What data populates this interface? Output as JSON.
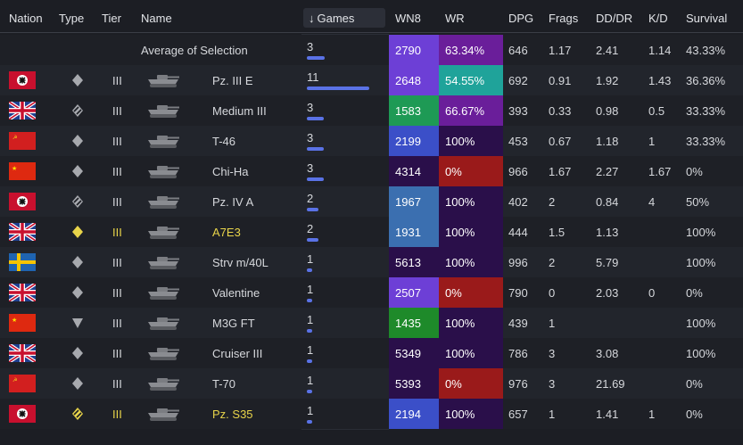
{
  "header": {
    "nation": "Nation",
    "type": "Type",
    "tier": "Tier",
    "name": "Name",
    "games": "Games",
    "wn8": "WN8",
    "wr": "WR",
    "dpg": "DPG",
    "frags": "Frags",
    "dddr": "DD/DR",
    "kd": "K/D",
    "survival": "Survival"
  },
  "average": {
    "label": "Average of Selection",
    "games": "3",
    "games_fraction": 0.2,
    "wn8": "2790",
    "wn8_color": "#6d3fd6",
    "wr": "63.34%",
    "wr_color": "#6a1e9a",
    "dpg": "646",
    "frags": "1.17",
    "dddr": "2.41",
    "kd": "1.14",
    "survival": "43.33%"
  },
  "rows": [
    {
      "nation": "germany",
      "type": "light-tank-icon",
      "tier": "III",
      "name": "Pz. III E",
      "premium": false,
      "games": "11",
      "games_fraction": 1.0,
      "wn8": "2648",
      "wn8_color": "#6d3fd6",
      "wr": "54.55%",
      "wr_color": "#1fa39a",
      "dpg": "692",
      "frags": "0.91",
      "dddr": "1.92",
      "kd": "1.43",
      "survival": "36.36%"
    },
    {
      "nation": "uk",
      "type": "medium-tank-icon",
      "tier": "III",
      "name": "Medium III",
      "premium": false,
      "games": "3",
      "games_fraction": 0.27,
      "wn8": "1583",
      "wn8_color": "#1e9a55",
      "wr": "66.67%",
      "wr_color": "#6a1e9a",
      "dpg": "393",
      "frags": "0.33",
      "dddr": "0.98",
      "kd": "0.5",
      "survival": "33.33%"
    },
    {
      "nation": "ussr",
      "type": "light-tank-icon",
      "tier": "III",
      "name": "T-46",
      "premium": false,
      "games": "3",
      "games_fraction": 0.27,
      "wn8": "2199",
      "wn8_color": "#3b4fc8",
      "wr": "100%",
      "wr_color": "#2a0f4a",
      "dpg": "453",
      "frags": "0.67",
      "dddr": "1.18",
      "kd": "1",
      "survival": "33.33%"
    },
    {
      "nation": "china",
      "type": "light-tank-icon",
      "tier": "III",
      "name": "Chi-Ha",
      "premium": false,
      "games": "3",
      "games_fraction": 0.27,
      "wn8": "4314",
      "wn8_color": "#2a0f4a",
      "wr": "0%",
      "wr_color": "#9a1a1a",
      "dpg": "966",
      "frags": "1.67",
      "dddr": "2.27",
      "kd": "1.67",
      "survival": "0%"
    },
    {
      "nation": "germany",
      "type": "medium-tank-icon",
      "tier": "III",
      "name": "Pz. IV A",
      "premium": false,
      "games": "2",
      "games_fraction": 0.18,
      "wn8": "1967",
      "wn8_color": "#3b6fb0",
      "wr": "100%",
      "wr_color": "#2a0f4a",
      "dpg": "402",
      "frags": "2",
      "dddr": "0.84",
      "kd": "4",
      "survival": "50%"
    },
    {
      "nation": "uk",
      "type": "light-tank-icon",
      "tier": "III",
      "name": "A7E3",
      "premium": true,
      "games": "2",
      "games_fraction": 0.18,
      "wn8": "1931",
      "wn8_color": "#3b6fb0",
      "wr": "100%",
      "wr_color": "#2a0f4a",
      "dpg": "444",
      "frags": "1.5",
      "dddr": "1.13",
      "kd": "",
      "survival": "100%"
    },
    {
      "nation": "sweden",
      "type": "light-tank-icon",
      "tier": "III",
      "name": "Strv m/40L",
      "premium": false,
      "games": "1",
      "games_fraction": 0.09,
      "wn8": "5613",
      "wn8_color": "#2a0f4a",
      "wr": "100%",
      "wr_color": "#2a0f4a",
      "dpg": "996",
      "frags": "2",
      "dddr": "5.79",
      "kd": "",
      "survival": "100%"
    },
    {
      "nation": "uk",
      "type": "light-tank-icon",
      "tier": "III",
      "name": "Valentine",
      "premium": false,
      "games": "1",
      "games_fraction": 0.09,
      "wn8": "2507",
      "wn8_color": "#6d3fd6",
      "wr": "0%",
      "wr_color": "#9a1a1a",
      "dpg": "790",
      "frags": "0",
      "dddr": "2.03",
      "kd": "0",
      "survival": "0%"
    },
    {
      "nation": "china",
      "type": "td-icon",
      "tier": "III",
      "name": "M3G FT",
      "premium": false,
      "games": "1",
      "games_fraction": 0.09,
      "wn8": "1435",
      "wn8_color": "#1e8a2a",
      "wr": "100%",
      "wr_color": "#2a0f4a",
      "dpg": "439",
      "frags": "1",
      "dddr": "",
      "kd": "",
      "survival": "100%"
    },
    {
      "nation": "uk",
      "type": "light-tank-icon",
      "tier": "III",
      "name": "Cruiser III",
      "premium": false,
      "games": "1",
      "games_fraction": 0.09,
      "wn8": "5349",
      "wn8_color": "#2a0f4a",
      "wr": "100%",
      "wr_color": "#2a0f4a",
      "dpg": "786",
      "frags": "3",
      "dddr": "3.08",
      "kd": "",
      "survival": "100%"
    },
    {
      "nation": "ussr",
      "type": "light-tank-icon",
      "tier": "III",
      "name": "T-70",
      "premium": false,
      "games": "1",
      "games_fraction": 0.09,
      "wn8": "5393",
      "wn8_color": "#2a0f4a",
      "wr": "0%",
      "wr_color": "#9a1a1a",
      "dpg": "976",
      "frags": "3",
      "dddr": "21.69",
      "kd": "",
      "survival": "0%"
    },
    {
      "nation": "germany",
      "type": "medium-tank-icon",
      "tier": "III",
      "name": "Pz. S35",
      "premium": true,
      "games": "1",
      "games_fraction": 0.09,
      "wn8": "2194",
      "wn8_color": "#3b4fc8",
      "wr": "100%",
      "wr_color": "#2a0f4a",
      "dpg": "657",
      "frags": "1",
      "dddr": "1.41",
      "kd": "1",
      "survival": "0%"
    }
  ],
  "colors": {
    "accent_bar": "#5a72e6",
    "premium_text": "#e8d44a"
  }
}
